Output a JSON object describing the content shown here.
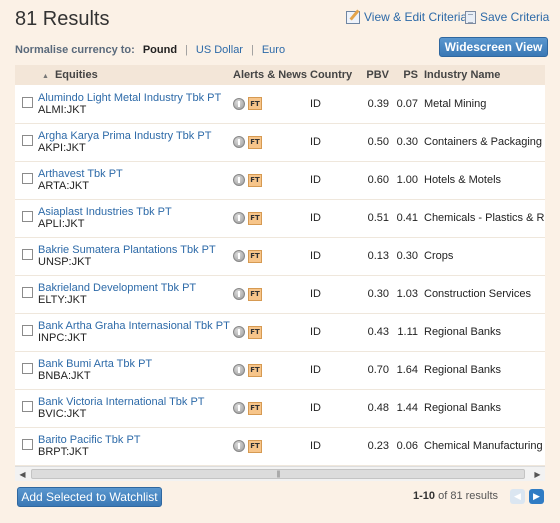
{
  "header": {
    "results_title": "81 Results",
    "view_edit_label": "View & Edit Criteria",
    "save_label": "Save Criteria",
    "widescreen_label": "Widescreen View"
  },
  "currency": {
    "label": "Normalise currency to:",
    "options": [
      "Pound",
      "US Dollar",
      "Euro"
    ],
    "selected": "Pound"
  },
  "table": {
    "columns": [
      "Equities",
      "Alerts & News",
      "Country",
      "PBV",
      "PS",
      "Industry Name"
    ],
    "ft_badge": "FT",
    "rows": [
      {
        "name": "Alumindo Light Metal Industry Tbk PT",
        "ticker": "ALMI:JKT",
        "country": "ID",
        "pbv": "0.39",
        "ps": "0.07",
        "industry": "Metal Mining"
      },
      {
        "name": "Argha Karya Prima Industry Tbk PT",
        "ticker": "AKPI:JKT",
        "country": "ID",
        "pbv": "0.50",
        "ps": "0.30",
        "industry": "Containers & Packaging"
      },
      {
        "name": "Arthavest Tbk PT",
        "ticker": "ARTA:JKT",
        "country": "ID",
        "pbv": "0.60",
        "ps": "1.00",
        "industry": "Hotels & Motels"
      },
      {
        "name": "Asiaplast Industries Tbk PT",
        "ticker": "APLI:JKT",
        "country": "ID",
        "pbv": "0.51",
        "ps": "0.41",
        "industry": "Chemicals - Plastics & Rub"
      },
      {
        "name": "Bakrie Sumatera Plantations Tbk PT",
        "ticker": "UNSP:JKT",
        "country": "ID",
        "pbv": "0.13",
        "ps": "0.30",
        "industry": "Crops"
      },
      {
        "name": "Bakrieland Development Tbk PT",
        "ticker": "ELTY:JKT",
        "country": "ID",
        "pbv": "0.30",
        "ps": "1.03",
        "industry": "Construction Services"
      },
      {
        "name": "Bank Artha Graha Internasional Tbk PT",
        "ticker": "INPC:JKT",
        "country": "ID",
        "pbv": "0.43",
        "ps": "1.11",
        "industry": "Regional Banks"
      },
      {
        "name": "Bank Bumi Arta Tbk PT",
        "ticker": "BNBA:JKT",
        "country": "ID",
        "pbv": "0.70",
        "ps": "1.64",
        "industry": "Regional Banks"
      },
      {
        "name": "Bank Victoria International Tbk PT",
        "ticker": "BVIC:JKT",
        "country": "ID",
        "pbv": "0.48",
        "ps": "1.44",
        "industry": "Regional Banks"
      },
      {
        "name": "Barito Pacific Tbk PT",
        "ticker": "BRPT:JKT",
        "country": "ID",
        "pbv": "0.23",
        "ps": "0.06",
        "industry": "Chemical Manufacturing"
      }
    ]
  },
  "footer": {
    "add_watchlist_label": "Add Selected to Watchlist",
    "pager_range": "1-10",
    "pager_of": "of 81 results"
  },
  "icons": {
    "view_edit": "edit-criteria-icon",
    "save": "save-icon",
    "alert": "alert-icon",
    "ft": "ft-news-icon",
    "sort": "sort-up-icon",
    "prev": "chevron-left-icon",
    "next": "chevron-right-icon"
  },
  "colors": {
    "background": "#fbf1e6",
    "link": "#2d6aa8",
    "button": "#3a78b5",
    "header_row": "#f3e6d8"
  }
}
